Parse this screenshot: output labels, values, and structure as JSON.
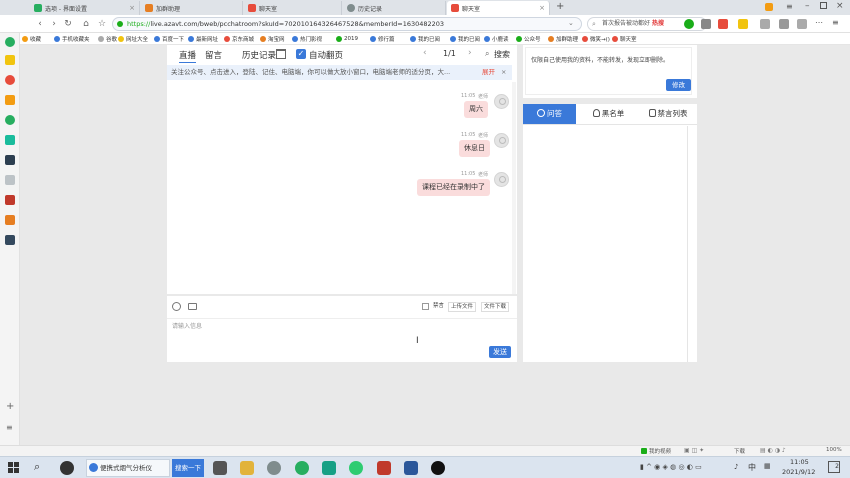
{
  "browser": {
    "tabs": [
      {
        "label": "选项 - 界面设置",
        "color": "#27ae60"
      },
      {
        "label": "加群助理",
        "color": "#e67e22"
      },
      {
        "label": "聊天室",
        "color": "#e74c3c"
      },
      {
        "label": "历史记录",
        "color": "#7f8c8d"
      },
      {
        "label": "聊天室",
        "color": "#e74c3c"
      }
    ],
    "active_tab_index": 4,
    "new_tab": "+",
    "url_scheme": "https://",
    "url_rest": "live.azavt.com/bweb/pcchatroom?skuId=702010164326467528&memberId=1630482203",
    "search_text": "首次报告被动都好",
    "search_hot": "热搜",
    "bookmarks": [
      "收藏",
      "手机收藏夹",
      "谷歌",
      "网址大全",
      "百度一下",
      "最新网址",
      "京东商城",
      "淘宝网",
      "热门影视",
      "2019",
      "修行篇",
      "我的已阅",
      "我的已阅",
      "小鹿读",
      "公众号",
      "加群助理",
      "微笑→()",
      "聊天室"
    ]
  },
  "chat": {
    "tabs": {
      "live": "直播",
      "comments": "留言",
      "history": "历史记录",
      "auto_scroll": "自动翻页"
    },
    "pager": "1/1",
    "search_label": "搜索",
    "notice": "关注公众号、点击进入，登陆、记住、电脑端，你可以做大放小窗口，电脑端老师的适分页，大...",
    "notice_expand": "展开",
    "notice_close": "×",
    "messages": [
      {
        "time": "11:05",
        "sender": "老师",
        "text": "周六"
      },
      {
        "time": "11:05",
        "sender": "老师",
        "text": "休息日"
      },
      {
        "time": "11:05",
        "sender": "老师",
        "text": "课程已经在录制中了"
      }
    ]
  },
  "composer": {
    "mute_label": "禁言",
    "upload_label": "上传文件",
    "download_label": "文件下载",
    "placeholder": "请输入信息",
    "send_label": "发送"
  },
  "notice_panel": {
    "text": "仅限自己使用我的资料，不能转发，发现立即删除。",
    "button": "修改"
  },
  "side_panel": {
    "tabs": [
      "问答",
      "黑名单",
      "禁言列表"
    ],
    "active": 0
  },
  "status_bar": {
    "items": [
      "我的视频",
      "下载",
      "100%"
    ]
  },
  "taskbar": {
    "search_text": "便携式烟气分析仪",
    "search_button": "搜索一下",
    "time": "11:05",
    "date": "2021/9/12",
    "lang": "中",
    "notifications": "2"
  }
}
